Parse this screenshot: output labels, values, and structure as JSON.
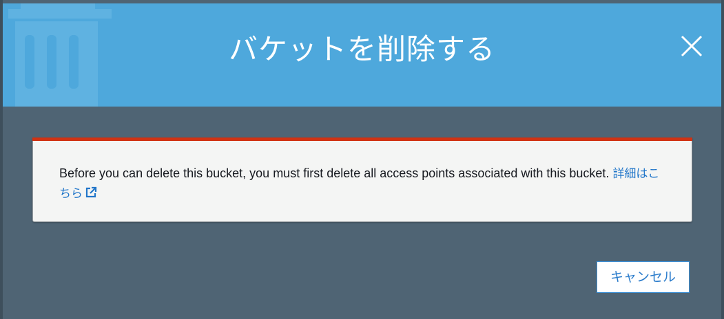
{
  "dialog": {
    "title": "バケットを削除する",
    "close_icon": "close-icon",
    "background_icon": "trash-icon"
  },
  "alert": {
    "message": "Before you can delete this bucket, you must first delete all access points associated with this bucket.",
    "link_label": "詳細はこちら",
    "link_icon": "external-link-icon",
    "accent_color": "#d13212"
  },
  "footer": {
    "cancel_label": "キャンセル"
  },
  "colors": {
    "header": "#4ea8dc",
    "body": "#4f6474",
    "link": "#2176c9"
  }
}
